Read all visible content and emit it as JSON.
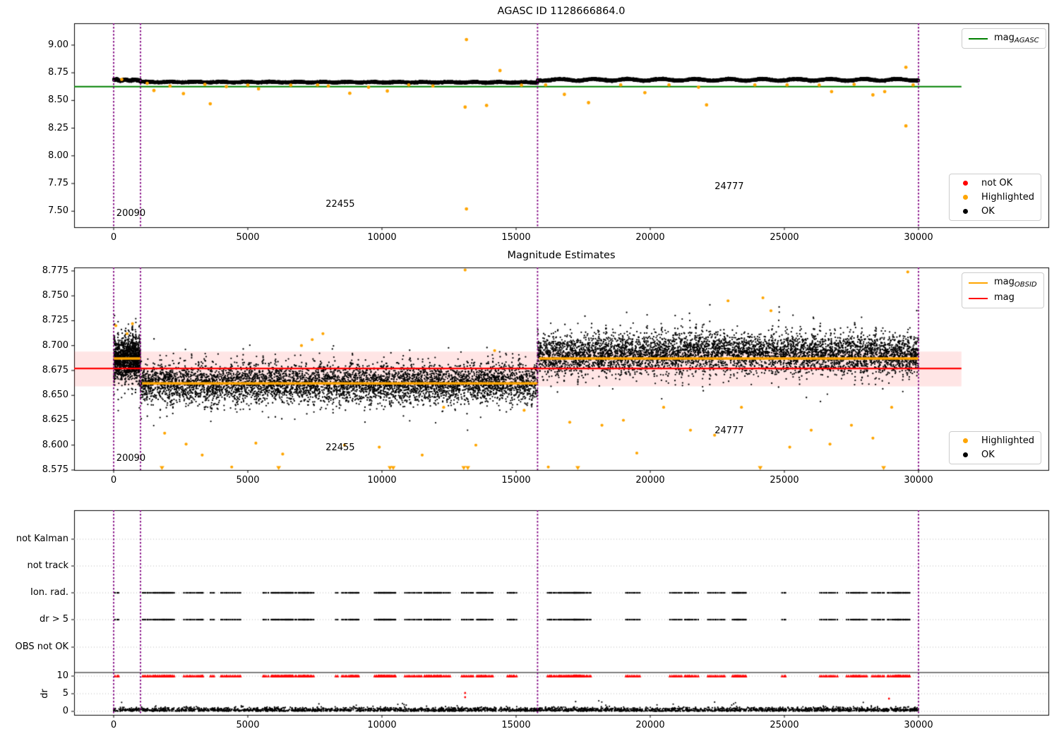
{
  "colors": {
    "ok": "#000000",
    "highlighted": "#ffa500",
    "not_ok": "#ff0000",
    "mag_agasc": "#008000",
    "mag": "#ff0000",
    "mag_obsid": "#ffa500",
    "divider": "#800080",
    "band_fill": "rgba(255,0,0,0.10)",
    "grid": "#b9b9b9"
  },
  "chart_data": [
    {
      "id": "top-mag-plot",
      "type": "scatter",
      "title": "AGASC ID 1128666864.0",
      "xlim": [
        -1474,
        34842
      ],
      "ylim": [
        7.355,
        9.197
      ],
      "xticks": [
        0,
        5000,
        10000,
        15000,
        20000,
        25000,
        30000
      ],
      "yticks": [
        "9.00",
        "8.75",
        "8.50",
        "8.25",
        "8.00",
        "7.75",
        "7.50"
      ],
      "ytick_values": [
        9.0,
        8.75,
        8.5,
        8.25,
        8.0,
        7.75,
        7.5
      ],
      "mag_agasc": 8.625,
      "line_x_end": 31600,
      "dividers": [
        0,
        1000,
        15800,
        30000
      ],
      "annotations": [
        {
          "text": "20090",
          "x": 100,
          "y": 7.44
        },
        {
          "text": "22455",
          "x": 7900,
          "y": 7.52
        },
        {
          "text": "24777",
          "x": 22400,
          "y": 7.68
        }
      ],
      "ok_band": {
        "segments": [
          {
            "x0": 0,
            "x1": 1000,
            "n": 240,
            "base": 8.684,
            "wave_amp": 0.005,
            "wave_period": 55,
            "slope": 0,
            "noise": 0.004
          },
          {
            "x0": 1000,
            "x1": 15800,
            "n": 2800,
            "base": 8.667,
            "wave_amp": 0.003,
            "wave_period": 150,
            "slope": -2.4e-07,
            "noise": 0.0028
          },
          {
            "x0": 15800,
            "x1": 30000,
            "n": 2700,
            "base": 8.6865,
            "wave_amp": 0.0075,
            "wave_period": 200,
            "slope": 0,
            "noise": 0.003
          }
        ]
      },
      "highlighted": [
        [
          300,
          8.69
        ],
        [
          1250,
          8.655
        ],
        [
          1500,
          8.59
        ],
        [
          2100,
          8.63
        ],
        [
          2600,
          8.562
        ],
        [
          3400,
          8.645
        ],
        [
          3600,
          8.47
        ],
        [
          4200,
          8.625
        ],
        [
          5000,
          8.638
        ],
        [
          5400,
          8.605
        ],
        [
          6600,
          8.638
        ],
        [
          7600,
          8.64
        ],
        [
          8000,
          8.63
        ],
        [
          8800,
          8.565
        ],
        [
          9500,
          8.62
        ],
        [
          10200,
          8.585
        ],
        [
          11000,
          8.64
        ],
        [
          11900,
          8.63
        ],
        [
          13150,
          9.05
        ],
        [
          13100,
          8.44
        ],
        [
          13150,
          7.52
        ],
        [
          13900,
          8.455
        ],
        [
          14400,
          8.77
        ],
        [
          15200,
          8.638
        ],
        [
          16100,
          8.64
        ],
        [
          16800,
          8.555
        ],
        [
          17700,
          8.48
        ],
        [
          18900,
          8.64
        ],
        [
          19800,
          8.57
        ],
        [
          20700,
          8.64
        ],
        [
          21800,
          8.62
        ],
        [
          22100,
          8.46
        ],
        [
          23900,
          8.64
        ],
        [
          25100,
          8.64
        ],
        [
          26300,
          8.638
        ],
        [
          26760,
          8.58
        ],
        [
          27600,
          8.645
        ],
        [
          28300,
          8.55
        ],
        [
          28740,
          8.58
        ],
        [
          29530,
          8.8
        ],
        [
          29530,
          8.27
        ],
        [
          29800,
          8.64
        ]
      ],
      "legend_line": [
        {
          "main": "mag",
          "sub": "AGASC",
          "color": "#008000"
        }
      ],
      "legend_flags": [
        {
          "label": "not OK",
          "color": "#ff0000"
        },
        {
          "label": "Highlighted",
          "color": "#ffa500"
        },
        {
          "label": "OK",
          "color": "#000000"
        }
      ]
    },
    {
      "id": "middle-estimates-plot",
      "type": "scatter",
      "title": "Magnitude Estimates",
      "xlim": [
        -1474,
        34842
      ],
      "ylim": [
        8.575,
        8.7785
      ],
      "xticks": [
        0,
        5000,
        10000,
        15000,
        20000,
        25000,
        30000
      ],
      "yticks": [
        "8.775",
        "8.750",
        "8.725",
        "8.700",
        "8.675",
        "8.650",
        "8.625",
        "8.600",
        "8.575"
      ],
      "ytick_values": [
        8.775,
        8.75,
        8.725,
        8.7,
        8.675,
        8.65,
        8.625,
        8.6,
        8.575
      ],
      "mag": 8.677,
      "mag_err_band": [
        8.659,
        8.694
      ],
      "line_x_end": 31600,
      "mag_obsid_segments": [
        {
          "x0": 0,
          "x1": 1000,
          "y": 8.687
        },
        {
          "x0": 1060,
          "x1": 15800,
          "y": 8.662
        },
        {
          "x0": 15860,
          "x1": 30000,
          "y": 8.687
        }
      ],
      "dividers": [
        0,
        1000,
        15800,
        30000
      ],
      "annotations": [
        {
          "text": "20090",
          "x": 100,
          "y": 8.582
        },
        {
          "text": "22455",
          "x": 7900,
          "y": 8.593
        },
        {
          "text": "24777",
          "x": 22400,
          "y": 8.61
        }
      ],
      "ok_cloud": {
        "segments": [
          {
            "x0": 0,
            "x1": 1000,
            "n": 1300,
            "base": 8.687,
            "core": 0.009,
            "spike": 0.016,
            "comb_period": 21,
            "arch": 0
          },
          {
            "x0": 1000,
            "x1": 15800,
            "n": 5400,
            "base": 8.6615,
            "core": 0.0085,
            "spike": 0.0125,
            "comb_period": 38,
            "arch": 0
          },
          {
            "x0": 15800,
            "x1": 30000,
            "n": 5400,
            "base": 8.69,
            "core": 0.009,
            "spike": 0.013,
            "comb_period": 41,
            "arch": 0.003
          }
        ]
      },
      "highlighted": [
        [
          80,
          8.72
        ],
        [
          500,
          8.712
        ],
        [
          700,
          8.722
        ],
        [
          1900,
          8.612
        ],
        [
          2700,
          8.601
        ],
        [
          3300,
          8.59
        ],
        [
          4400,
          8.578
        ],
        [
          5300,
          8.602
        ],
        [
          6300,
          8.591
        ],
        [
          7000,
          8.7
        ],
        [
          7400,
          8.706
        ],
        [
          7800,
          8.712
        ],
        [
          8600,
          8.6
        ],
        [
          9900,
          8.598
        ],
        [
          11500,
          8.59
        ],
        [
          12300,
          8.638
        ],
        [
          13100,
          8.776
        ],
        [
          13500,
          8.6
        ],
        [
          14200,
          8.695
        ],
        [
          15300,
          8.635
        ],
        [
          16200,
          8.578
        ],
        [
          17000,
          8.623
        ],
        [
          18200,
          8.62
        ],
        [
          19000,
          8.625
        ],
        [
          19500,
          8.592
        ],
        [
          20500,
          8.638
        ],
        [
          21500,
          8.615
        ],
        [
          22400,
          8.61
        ],
        [
          22900,
          8.745
        ],
        [
          23400,
          8.638
        ],
        [
          24200,
          8.748
        ],
        [
          24500,
          8.735
        ],
        [
          25200,
          8.598
        ],
        [
          26000,
          8.615
        ],
        [
          26700,
          8.601
        ],
        [
          27500,
          8.62
        ],
        [
          28300,
          8.607
        ],
        [
          29000,
          8.638
        ],
        [
          29600,
          8.774
        ]
      ],
      "clipped_low_x": [
        1800,
        6150,
        10300,
        10420,
        13050,
        13200,
        17300,
        24100,
        28700
      ],
      "legend_lines": [
        {
          "main": "mag",
          "sub": "OBSID",
          "color": "#ffa500"
        },
        {
          "main": "mag",
          "sub": "",
          "color": "#ff0000"
        }
      ],
      "legend_flags": [
        {
          "label": "Highlighted",
          "color": "#ffa500"
        },
        {
          "label": "OK",
          "color": "#000000"
        }
      ]
    },
    {
      "id": "bottom-flags-plot",
      "type": "scatter",
      "ylabel": "dr",
      "xlim": [
        -1474,
        34842
      ],
      "xticks": [
        0,
        5000,
        10000,
        15000,
        20000,
        25000,
        30000
      ],
      "flag_rows": [
        "not Kalman",
        "not track",
        "Ion. rad.",
        "dr > 5",
        "OBS not OK"
      ],
      "dr_ticks": [
        "10",
        "5",
        "0"
      ],
      "dividers": [
        0,
        1000,
        15800,
        30000
      ],
      "separator_dr": 11,
      "flag_clusters": {
        "n": 52,
        "x_min": 1500,
        "x_max": 29800,
        "forced": [
          60,
          1080,
          1260,
          1520
        ],
        "size_min": 2,
        "size_max": 13,
        "pitch": 62
      },
      "dr_baseline": {
        "n": 3200,
        "spread": 0.5
      },
      "dr_specials": [
        [
          13100,
          4.0
        ],
        [
          13100,
          5.2
        ],
        [
          28900,
          3.6
        ]
      ]
    }
  ]
}
